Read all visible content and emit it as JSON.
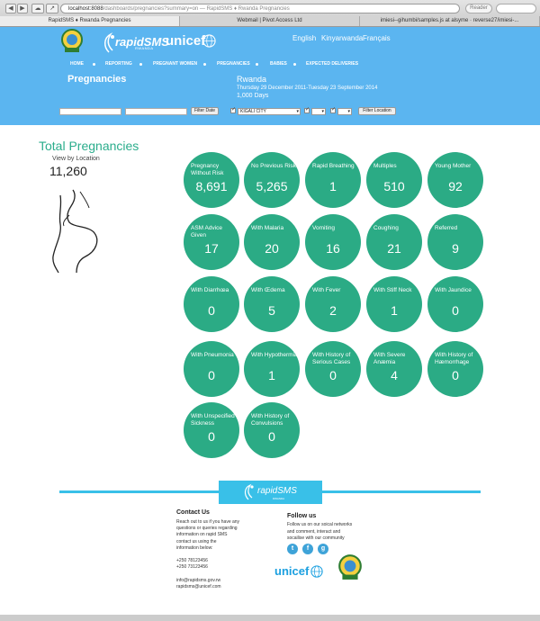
{
  "browser": {
    "tabs": [
      "RapidSMS ♦ Rwanda Pregnancies",
      "Webmail | Pivot Access Ltd",
      "imiesi--gihumbi/samples.js at alsyme · reverse27/imiesi-..."
    ],
    "url_host": "localhost:8088",
    "url_path": "/dashboards/pregnancies?summary=on",
    "url_title": " — RapidSMS ♦ Rwanda Pregnancies",
    "reader_label": "Reader"
  },
  "header": {
    "logo_text": "rapidSMS",
    "logo_sub": "RWANDA",
    "unicef": "unicef",
    "languages": [
      "English",
      "Kinyarwanda",
      "Français"
    ],
    "nav": [
      "Home",
      "Reporting",
      "Pregnant Women",
      "Pregnancies",
      "Babies",
      "Expected Deliveries"
    ],
    "page_title": "Pregnancies",
    "region": "Rwanda",
    "date_range": "Thursday 29 December 2011-Tuesday 23 September 2014",
    "days": "1,000 Days",
    "filters": {
      "filter_date_label": "Filter Date",
      "location_value": "KIGALI CITY",
      "filter_location_label": "Filter Location"
    }
  },
  "summary": {
    "title": "Total Pregnancies",
    "view_by": "View by Location",
    "total": "11,260"
  },
  "indicators": [
    {
      "label": "Pregnancy Without Risk",
      "value": "8,691"
    },
    {
      "label": "No Previous Risk",
      "value": "5,265"
    },
    {
      "label": "Rapid Breathing",
      "value": "1"
    },
    {
      "label": "Multiples",
      "value": "510"
    },
    {
      "label": "Young Mother",
      "value": "92"
    },
    {
      "label": "ASM Advice Given",
      "value": "17"
    },
    {
      "label": "With Malaria",
      "value": "20"
    },
    {
      "label": "Vomiting",
      "value": "16"
    },
    {
      "label": "Coughing",
      "value": "21"
    },
    {
      "label": "Referred",
      "value": "9"
    },
    {
      "label": "With Diarrhœa",
      "value": "0"
    },
    {
      "label": "With Œdema",
      "value": "5"
    },
    {
      "label": "With Fever",
      "value": "2"
    },
    {
      "label": "With Stiff Neck",
      "value": "1"
    },
    {
      "label": "With Jaundice",
      "value": "0"
    },
    {
      "label": "With Pneumonia",
      "value": "0"
    },
    {
      "label": "With Hypothermia",
      "value": "1"
    },
    {
      "label": "With History of Serious Cases",
      "value": "0"
    },
    {
      "label": "With Severe Anæmia",
      "value": "4"
    },
    {
      "label": "With History of Hæmorrhage",
      "value": "0"
    },
    {
      "label": "With Unspecified Sickness",
      "value": "0"
    },
    {
      "label": "With History of Convulsions",
      "value": "0"
    }
  ],
  "footer": {
    "logo_text": "rapidSMS",
    "logo_sub": "RWANDA",
    "contact": {
      "title": "Contact Us",
      "lines": [
        "Reach out to us if you have any",
        "questions or queries regarding",
        "information on rapid SMS",
        "contact us using the",
        "information below:",
        "",
        "+250 78123456",
        "+250 73123456",
        "",
        "info@rapidsms.gov.rw",
        "rapidsms@unicef.com"
      ]
    },
    "follow": {
      "title": "Follow us",
      "lines": [
        "Follow us on our soical networks",
        "and comment, interact and",
        "socailise with our community"
      ],
      "socials": [
        "twitter-icon",
        "facebook-icon",
        "google-plus-icon"
      ]
    },
    "unicef": "unicef"
  },
  "colors": {
    "header_bg": "#5bb5f0",
    "circle_bg": "#2bab85",
    "title_green": "#2bad8c",
    "footer_accent": "#39c0e8"
  }
}
